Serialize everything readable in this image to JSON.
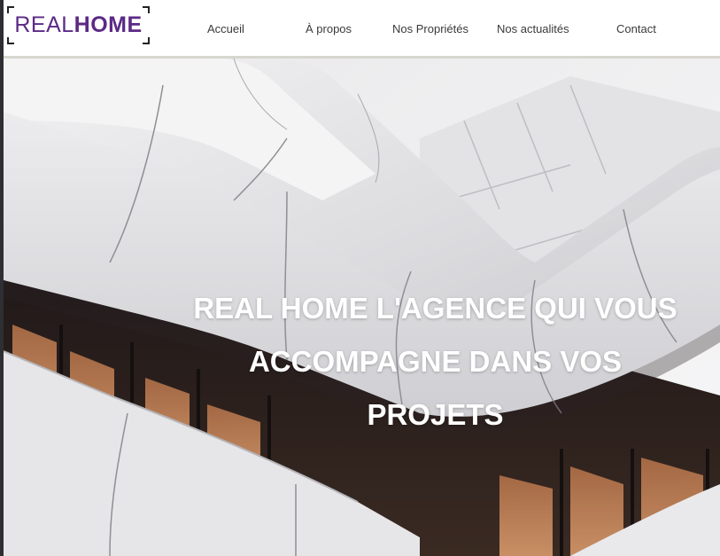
{
  "header": {
    "logo": {
      "part1": "REAL",
      "part2": "HOME",
      "color": "#5c2a86"
    },
    "nav": [
      {
        "label": "Accueil"
      },
      {
        "label": "À propos"
      },
      {
        "label": "Nos Propriétés"
      },
      {
        "label": "Nos actualités"
      },
      {
        "label": "Contact"
      }
    ]
  },
  "hero": {
    "title_lines": [
      "REAL HOME L'AGENCE QUI VOUS",
      "ACCOMPAGNE DANS VOS",
      "PROJETS"
    ],
    "image": "modern-white-building-photo"
  }
}
